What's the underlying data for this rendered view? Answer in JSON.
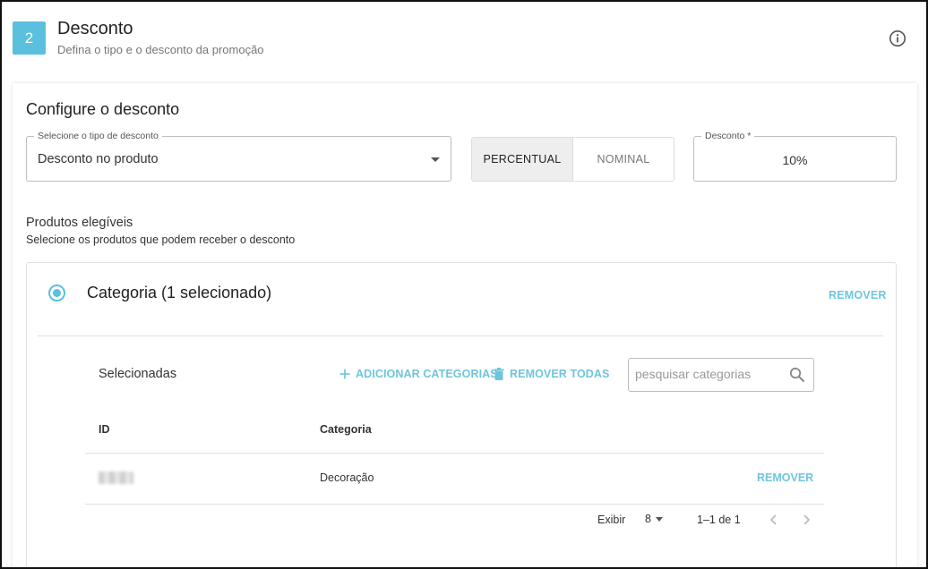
{
  "step": {
    "number": "2",
    "title": "Desconto",
    "subtitle": "Defina o tipo e o desconto da promoção"
  },
  "config": {
    "title": "Configure o desconto",
    "type_select": {
      "label": "Selecione o tipo de desconto",
      "value": "Desconto no produto"
    },
    "mode_toggle": {
      "options": [
        "PERCENTUAL",
        "NOMINAL"
      ],
      "selected": "PERCENTUAL"
    },
    "discount": {
      "label": "Desconto *",
      "value": "10%"
    }
  },
  "eligible": {
    "title": "Produtos elegíveis",
    "subtitle": "Selecione os produtos que podem receber o desconto"
  },
  "category_panel": {
    "title": "Categoria (1 selecionado)",
    "remove_label": "REMOVER",
    "selected_label": "Selecionadas",
    "add_label": "ADICIONAR CATEGORIAS",
    "remove_all_label": "REMOVER TODAS",
    "search_placeholder": "pesquisar categorias",
    "table": {
      "headers": [
        "ID",
        "Categoria"
      ],
      "rows": [
        {
          "id": "",
          "categoria": "Decoração",
          "action": "REMOVER"
        }
      ]
    },
    "pagination": {
      "show_label": "Exibir",
      "page_size": "8",
      "range": "1–1 de 1"
    }
  },
  "colors": {
    "accent": "#5bc0de",
    "link": "#6ec5dd"
  },
  "icons": {
    "info": "info-icon",
    "search": "search-icon",
    "add": "plus-icon",
    "delete": "trash-icon",
    "prev": "chevron-left-icon",
    "next": "chevron-right-icon"
  }
}
